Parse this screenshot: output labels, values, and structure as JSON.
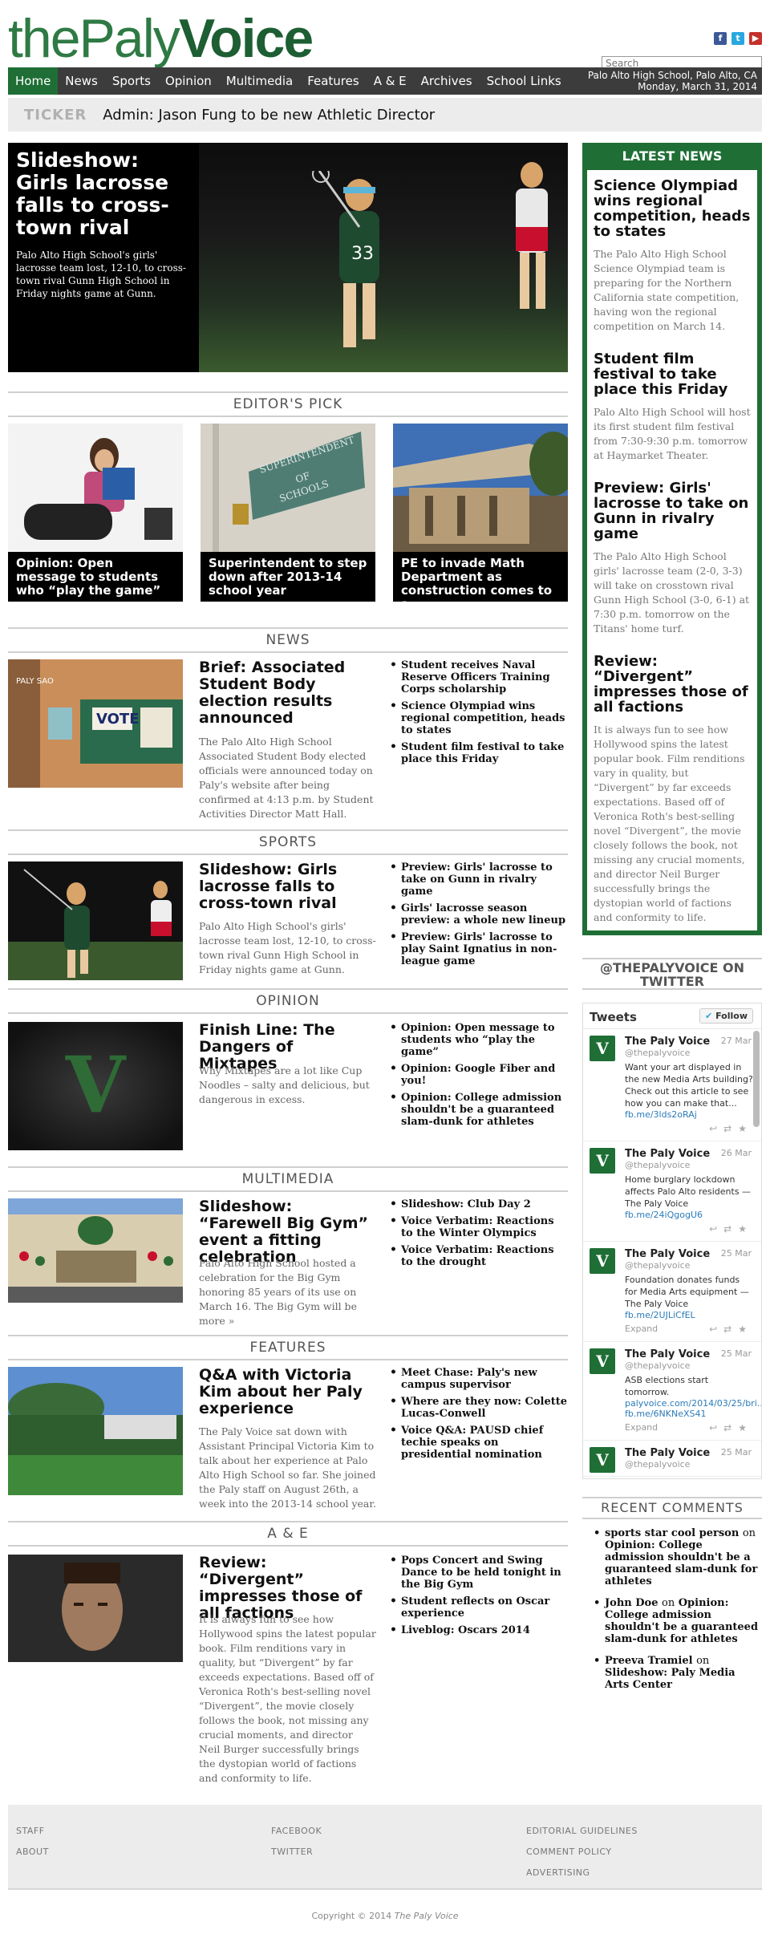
{
  "site": {
    "logo_part1": "the",
    "logo_part2": "Paly",
    "logo_part3": "Voice",
    "search_placeholder": "Search",
    "location": "Palo Alto High School, Palo Alto, CA",
    "date": "Monday, March 31, 2014"
  },
  "nav": [
    "Home",
    "News",
    "Sports",
    "Opinion",
    "Multimedia",
    "Features",
    "A & E",
    "Archives",
    "School Links"
  ],
  "ticker": {
    "label": "TICKER",
    "text": "Admin: Jason Fung to be new Athletic Director"
  },
  "hero": {
    "title": "Slideshow: Girls lacrosse falls to cross-town rival",
    "desc": "Palo Alto High School's girls' lacrosse team lost, 12-10, to cross-town rival Gunn High School in Friday nights game at Gunn."
  },
  "editors_pick": {
    "header": "EDITOR'S PICK",
    "items": [
      "Opinion: Open message to students who “play the game”",
      "Superintendent to step down after 2013-14 school year",
      "PE to invade Math Department as construction comes to a"
    ],
    "sign_line1": "SUPERINTENDENT",
    "sign_line2": "OF",
    "sign_line3": "SCHOOLS"
  },
  "sections": {
    "news": {
      "header": "NEWS",
      "headline": "Brief: Associated Student Body election results announced",
      "desc": "The Palo Alto High School Associated Student Body elected officials were announced today on Paly's website after being confirmed at 4:13 p.m. by Student Activities Director Matt Hall.",
      "links": [
        "Student receives Naval Reserve Officers Training Corps scholarship",
        "Science Olympiad wins regional competition, heads to states",
        "Student film festival to take place this Friday"
      ],
      "thumb_sign": "PALY SAO",
      "thumb_vote": "VOTE"
    },
    "sports": {
      "header": "SPORTS",
      "headline": "Slideshow: Girls lacrosse falls to cross-town rival",
      "desc": "Palo Alto High School's girls' lacrosse team lost, 12-10, to cross-town rival Gunn High School in Friday nights game at Gunn.",
      "links": [
        "Preview: Girls' lacrosse to take on Gunn in rivalry game",
        "Girls' lacrosse season preview: a whole new lineup",
        "Preview: Girls' lacrosse to play Saint Ignatius in non-league game"
      ]
    },
    "opinion": {
      "header": "OPINION",
      "headline": "Finish Line: The Dangers of Mixtapes",
      "desc": "Why Mixtapes are a lot like Cup Noodles – salty and delicious, but dangerous in excess.",
      "links": [
        "Opinion: Open message to students who “play the game”",
        "Opinion: Google Fiber and you!",
        "Opinion: College admission shouldn't be a guaranteed slam-dunk for athletes"
      ],
      "thumb_letter": "V"
    },
    "multimedia": {
      "header": "MULTIMEDIA",
      "headline": "Slideshow: “Farewell Big Gym” event a fitting celebration",
      "desc": "Palo Alto High School hosted a celebration for the Big Gym honoring 85 years of its use on March 16. The Big Gym will be more »",
      "links": [
        "Slideshow: Club Day 2",
        "Voice Verbatim: Reactions to the Winter Olympics",
        "Voice Verbatim: Reactions to the drought"
      ]
    },
    "features": {
      "header": "FEATURES",
      "headline": "Q&A with Victoria Kim about her Paly experience",
      "desc": "The Paly Voice sat down with Assistant Principal Victoria Kim to talk about her experience at Palo Alto High School so far. She joined the Paly staff on August 26th, a week into the 2013-14 school year.",
      "links": [
        "Meet Chase: Paly's new campus supervisor",
        "Where are they now: Colette Lucas-Conwell",
        "Voice Q&A: PAUSD chief techie speaks on presidential nomination"
      ]
    },
    "ae": {
      "header": "A & E",
      "headline": "Review: “Divergent” impresses those of all factions",
      "desc": "It is always fun to see how Hollywood spins the latest popular book. Film renditions vary in quality, but “Divergent” by far exceeds expectations. Based off of Veronica Roth's best-selling novel “Divergent”, the movie closely follows the book, not missing any crucial moments, and director Neil Burger successfully brings the dystopian world of factions and conformity to life.",
      "links": [
        "Pops Concert and Swing Dance to be held tonight in the Big Gym",
        "Student reflects on Oscar experience",
        "Liveblog: Oscars 2014"
      ]
    }
  },
  "latest_news": {
    "header": "LATEST NEWS",
    "items": [
      {
        "title": "Science Olympiad wins regional competition, heads to states",
        "desc": "The Palo Alto High School Science Olympiad team is preparing for the Northern California state competition, having won the regional competition on March 14."
      },
      {
        "title": "Student film festival to take place this Friday",
        "desc": "Palo Alto High School will host its first student film festival from 7:30-9:30 p.m. tomorrow at Haymarket Theater."
      },
      {
        "title": "Preview: Girls' lacrosse to take on Gunn in rivalry game",
        "desc": "The Palo Alto High School girls' lacrosse team (2-0, 3-3) will take on crosstown rival Gunn High School (3-0, 6-1) at 7:30 p.m. tomorrow on the Titans' home turf."
      },
      {
        "title": "Review: “Divergent” impresses those of all factions",
        "desc": "It is always fun to see how Hollywood spins the latest popular book. Film renditions vary in quality, but “Divergent” by far exceeds expectations. Based off of Veronica Roth's best-selling novel “Divergent”, the movie closely follows the book, not missing any crucial moments, and director Neil Burger successfully brings the dystopian world of factions and conformity to life."
      }
    ]
  },
  "twitter": {
    "header": "@THEPALYVOICE ON TWITTER",
    "title": "Tweets",
    "follow": "Follow",
    "tweets": [
      {
        "name": "The Paly Voice",
        "handle": "@thepalyvoice",
        "date": "27 Mar",
        "text": "Want your art displayed in the new Media Arts building? Check out this article to see how you can make that...",
        "link": "fb.me/3lds2oRAj",
        "expand": ""
      },
      {
        "name": "The Paly Voice",
        "handle": "@thepalyvoice",
        "date": "26 Mar",
        "text": "Home burglary lockdown affects Palo Alto residents — The Paly Voice",
        "link": "fb.me/24iQgogU6",
        "expand": ""
      },
      {
        "name": "The Paly Voice",
        "handle": "@thepalyvoice",
        "date": "25 Mar",
        "text": "Foundation donates funds for Media Arts equipment — The Paly Voice",
        "link": "fb.me/2UJLiCfEL",
        "expand": "Expand"
      },
      {
        "name": "The Paly Voice",
        "handle": "@thepalyvoice",
        "date": "25 Mar",
        "text": "ASB elections start tomorrow.",
        "link": "palyvoice.com/2014/03/25/bri... fb.me/6NKNeXS41",
        "expand": "Expand"
      },
      {
        "name": "The Paly Voice",
        "handle": "@thepalyvoice",
        "date": "25 Mar",
        "text": "",
        "link": "",
        "expand": ""
      }
    ]
  },
  "recent_comments": {
    "header": "RECENT COMMENTS",
    "items": [
      {
        "author": "sports star cool person",
        "on": "on",
        "title": "Opinion: College admission shouldn't be a guaranteed slam-dunk for athletes"
      },
      {
        "author": "John Doe",
        "on": "on",
        "title": "Opinion: College admission shouldn't be a guaranteed slam-dunk for athletes"
      },
      {
        "author": "Preeva Tramiel",
        "on": "on",
        "title": "Slideshow: Paly Media Arts Center"
      }
    ]
  },
  "footer": {
    "col1": [
      "STAFF",
      "ABOUT"
    ],
    "col2": [
      "FACEBOOK",
      "TWITTER"
    ],
    "col3": [
      "EDITORIAL GUIDELINES",
      "COMMENT POLICY",
      "ADVERTISING"
    ],
    "copyright": "Copyright © 2014",
    "copyright_brand": "The Paly Voice"
  },
  "colors": {
    "brand_green": "#1f6e35",
    "nav_bg": "#3c3c3c",
    "ticker_bg": "#ececec"
  }
}
